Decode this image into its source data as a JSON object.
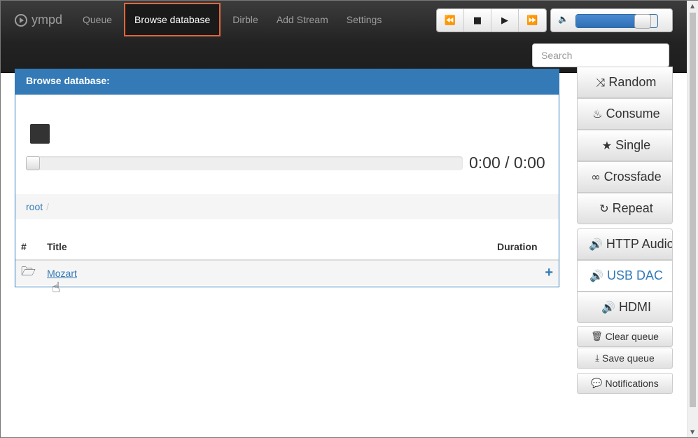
{
  "brand": {
    "label": "ympd",
    "icon": "play-circle-icon"
  },
  "nav": {
    "items": [
      {
        "label": "Queue",
        "active": false
      },
      {
        "label": "Browse database",
        "active": true
      },
      {
        "label": "Dirble",
        "active": false
      },
      {
        "label": "Add Stream",
        "active": false
      },
      {
        "label": "Settings",
        "active": false
      }
    ]
  },
  "transport": {
    "prev": "⏪",
    "stop": "■",
    "play": "▶",
    "next": "⏩",
    "icons": [
      "fast-backward-icon",
      "stop-icon",
      "play-icon",
      "fast-forward-icon"
    ]
  },
  "volume": {
    "icon": "🔈",
    "level_percent": 81
  },
  "search": {
    "placeholder": "Search",
    "value": ""
  },
  "panel": {
    "heading": "Browse database:",
    "progress_percent": 0,
    "time": "0:00 / 0:00"
  },
  "breadcrumb": {
    "root": "root",
    "separator": "/"
  },
  "table": {
    "columns": [
      "#",
      "Title",
      "Duration"
    ],
    "rows": [
      {
        "icon": "folder-open-icon",
        "title": "Mozart",
        "duration": ""
      }
    ]
  },
  "sidebar": {
    "random": "Random",
    "consume": "Consume",
    "single": "Single",
    "crossfade": "Crossfade",
    "repeat": "Repeat",
    "http_audio": "HTTP Audio",
    "usb_dac": "USB DAC",
    "hdmi": "HDMI",
    "clear_queue": "Clear queue",
    "save_queue": "Save queue",
    "notifications": "Notifications"
  },
  "colors": {
    "accent": "#337ab7",
    "active_nav_border": "#e0673a",
    "navbar": "#222222"
  }
}
